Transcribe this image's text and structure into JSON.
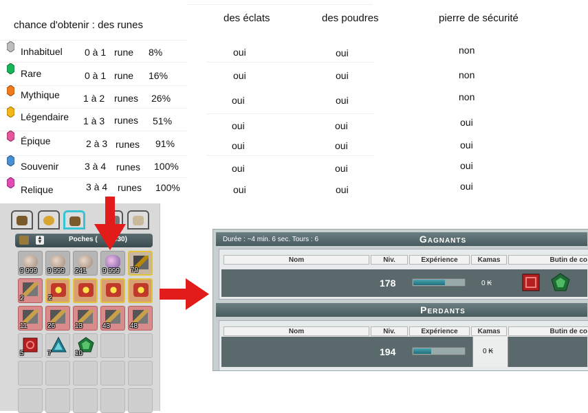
{
  "table": {
    "header_runes": "chance d'obtenir : des runes",
    "header_eclats": "des éclats",
    "header_poudres": "des poudres",
    "header_pierre": "pierre de sécurité",
    "rows": [
      {
        "rarity": "Inhabituel",
        "qty": "0 à 1",
        "unit": "rune",
        "pct": "8%",
        "eclats": "oui",
        "poudres": "oui",
        "pierre": "non",
        "gem_color": "#bdbdbd"
      },
      {
        "rarity": "Rare",
        "qty": "0 à 1",
        "unit": "rune",
        "pct": "16%",
        "eclats": "oui",
        "poudres": "oui",
        "pierre": "non",
        "gem_color": "#19b55a"
      },
      {
        "rarity": "Mythique",
        "qty": "1 à 2",
        "unit": "runes",
        "pct": "26%",
        "eclats": "oui",
        "poudres": "oui",
        "pierre": "non",
        "gem_color": "#f07b1c"
      },
      {
        "rarity": "Légendaire",
        "qty": "1 à 3",
        "unit": "runes",
        "pct": "51%",
        "eclats": "oui",
        "poudres": "oui",
        "pierre": "oui",
        "gem_color": "#f3b51a"
      },
      {
        "rarity": "Épique",
        "qty": "2 à 3",
        "unit": "runes",
        "pct": "91%",
        "eclats": "oui",
        "poudres": "oui",
        "pierre": "oui",
        "gem_color": "#e5579b"
      },
      {
        "rarity": "Souvenir",
        "qty": "3 à 4",
        "unit": "runes",
        "pct": "100%",
        "eclats": "oui",
        "poudres": "oui",
        "pierre": "oui",
        "gem_color": "#4a8fd0"
      },
      {
        "rarity": "Relique",
        "qty": "3 à 4",
        "unit": "runes",
        "pct": "100%",
        "eclats": "oui",
        "poudres": "oui",
        "pierre": "oui",
        "gem_color": "#e24bb4"
      }
    ]
  },
  "inventory": {
    "pocket_title": "Poches (",
    "pocket_count": "/30)",
    "quantities": [
      "9 999",
      "9 999",
      "241",
      "9 999",
      "79",
      "2",
      "2",
      "",
      "",
      "",
      "11",
      "26",
      "13",
      "43",
      "48",
      "5",
      "7",
      "10"
    ]
  },
  "battle": {
    "duration": "Durée : ~4 min. 6 sec. Tours : 6",
    "winners_title": "Gagnants",
    "losers_title": "Perdants",
    "col_nom": "Nom",
    "col_niv": "Niv.",
    "col_xp": "Expérience",
    "col_kamas": "Kamas",
    "col_butin": "Butin de co",
    "winner_level": "178",
    "winner_kamas": "0 ₭",
    "winner_xp_fraction": 0.62,
    "loser_level": "194",
    "loser_kamas": "0 ₭",
    "loser_xp_fraction": 0.35
  },
  "colors": {
    "arrow_red": "#e21b1b",
    "tab_active": "#39c3d3"
  }
}
